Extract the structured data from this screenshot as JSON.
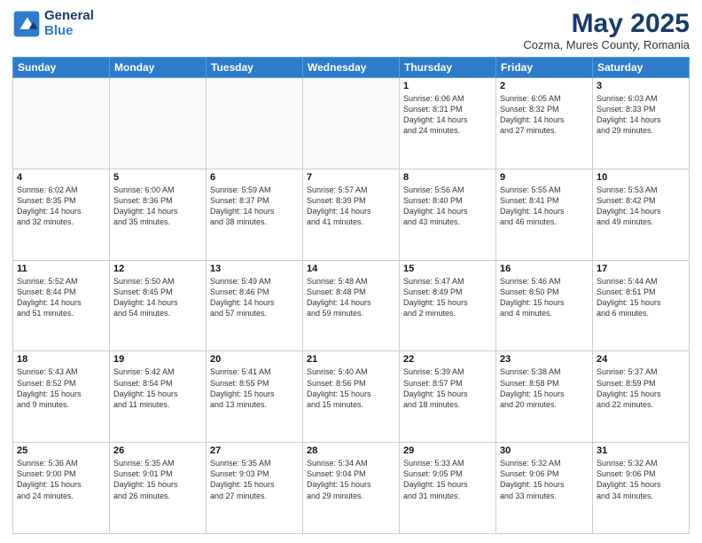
{
  "header": {
    "logo_line1": "General",
    "logo_line2": "Blue",
    "title": "May 2025",
    "subtitle": "Cozma, Mures County, Romania"
  },
  "days_of_week": [
    "Sunday",
    "Monday",
    "Tuesday",
    "Wednesday",
    "Thursday",
    "Friday",
    "Saturday"
  ],
  "weeks": [
    [
      {
        "day": "",
        "info": ""
      },
      {
        "day": "",
        "info": ""
      },
      {
        "day": "",
        "info": ""
      },
      {
        "day": "",
        "info": ""
      },
      {
        "day": "1",
        "info": "Sunrise: 6:06 AM\nSunset: 8:31 PM\nDaylight: 14 hours\nand 24 minutes."
      },
      {
        "day": "2",
        "info": "Sunrise: 6:05 AM\nSunset: 8:32 PM\nDaylight: 14 hours\nand 27 minutes."
      },
      {
        "day": "3",
        "info": "Sunrise: 6:03 AM\nSunset: 8:33 PM\nDaylight: 14 hours\nand 29 minutes."
      }
    ],
    [
      {
        "day": "4",
        "info": "Sunrise: 6:02 AM\nSunset: 8:35 PM\nDaylight: 14 hours\nand 32 minutes."
      },
      {
        "day": "5",
        "info": "Sunrise: 6:00 AM\nSunset: 8:36 PM\nDaylight: 14 hours\nand 35 minutes."
      },
      {
        "day": "6",
        "info": "Sunrise: 5:59 AM\nSunset: 8:37 PM\nDaylight: 14 hours\nand 38 minutes."
      },
      {
        "day": "7",
        "info": "Sunrise: 5:57 AM\nSunset: 8:39 PM\nDaylight: 14 hours\nand 41 minutes."
      },
      {
        "day": "8",
        "info": "Sunrise: 5:56 AM\nSunset: 8:40 PM\nDaylight: 14 hours\nand 43 minutes."
      },
      {
        "day": "9",
        "info": "Sunrise: 5:55 AM\nSunset: 8:41 PM\nDaylight: 14 hours\nand 46 minutes."
      },
      {
        "day": "10",
        "info": "Sunrise: 5:53 AM\nSunset: 8:42 PM\nDaylight: 14 hours\nand 49 minutes."
      }
    ],
    [
      {
        "day": "11",
        "info": "Sunrise: 5:52 AM\nSunset: 8:44 PM\nDaylight: 14 hours\nand 51 minutes."
      },
      {
        "day": "12",
        "info": "Sunrise: 5:50 AM\nSunset: 8:45 PM\nDaylight: 14 hours\nand 54 minutes."
      },
      {
        "day": "13",
        "info": "Sunrise: 5:49 AM\nSunset: 8:46 PM\nDaylight: 14 hours\nand 57 minutes."
      },
      {
        "day": "14",
        "info": "Sunrise: 5:48 AM\nSunset: 8:48 PM\nDaylight: 14 hours\nand 59 minutes."
      },
      {
        "day": "15",
        "info": "Sunrise: 5:47 AM\nSunset: 8:49 PM\nDaylight: 15 hours\nand 2 minutes."
      },
      {
        "day": "16",
        "info": "Sunrise: 5:46 AM\nSunset: 8:50 PM\nDaylight: 15 hours\nand 4 minutes."
      },
      {
        "day": "17",
        "info": "Sunrise: 5:44 AM\nSunset: 8:51 PM\nDaylight: 15 hours\nand 6 minutes."
      }
    ],
    [
      {
        "day": "18",
        "info": "Sunrise: 5:43 AM\nSunset: 8:52 PM\nDaylight: 15 hours\nand 9 minutes."
      },
      {
        "day": "19",
        "info": "Sunrise: 5:42 AM\nSunset: 8:54 PM\nDaylight: 15 hours\nand 11 minutes."
      },
      {
        "day": "20",
        "info": "Sunrise: 5:41 AM\nSunset: 8:55 PM\nDaylight: 15 hours\nand 13 minutes."
      },
      {
        "day": "21",
        "info": "Sunrise: 5:40 AM\nSunset: 8:56 PM\nDaylight: 15 hours\nand 15 minutes."
      },
      {
        "day": "22",
        "info": "Sunrise: 5:39 AM\nSunset: 8:57 PM\nDaylight: 15 hours\nand 18 minutes."
      },
      {
        "day": "23",
        "info": "Sunrise: 5:38 AM\nSunset: 8:58 PM\nDaylight: 15 hours\nand 20 minutes."
      },
      {
        "day": "24",
        "info": "Sunrise: 5:37 AM\nSunset: 8:59 PM\nDaylight: 15 hours\nand 22 minutes."
      }
    ],
    [
      {
        "day": "25",
        "info": "Sunrise: 5:36 AM\nSunset: 9:00 PM\nDaylight: 15 hours\nand 24 minutes."
      },
      {
        "day": "26",
        "info": "Sunrise: 5:35 AM\nSunset: 9:01 PM\nDaylight: 15 hours\nand 26 minutes."
      },
      {
        "day": "27",
        "info": "Sunrise: 5:35 AM\nSunset: 9:03 PM\nDaylight: 15 hours\nand 27 minutes."
      },
      {
        "day": "28",
        "info": "Sunrise: 5:34 AM\nSunset: 9:04 PM\nDaylight: 15 hours\nand 29 minutes."
      },
      {
        "day": "29",
        "info": "Sunrise: 5:33 AM\nSunset: 9:05 PM\nDaylight: 15 hours\nand 31 minutes."
      },
      {
        "day": "30",
        "info": "Sunrise: 5:32 AM\nSunset: 9:06 PM\nDaylight: 15 hours\nand 33 minutes."
      },
      {
        "day": "31",
        "info": "Sunrise: 5:32 AM\nSunset: 9:06 PM\nDaylight: 15 hours\nand 34 minutes."
      }
    ]
  ]
}
